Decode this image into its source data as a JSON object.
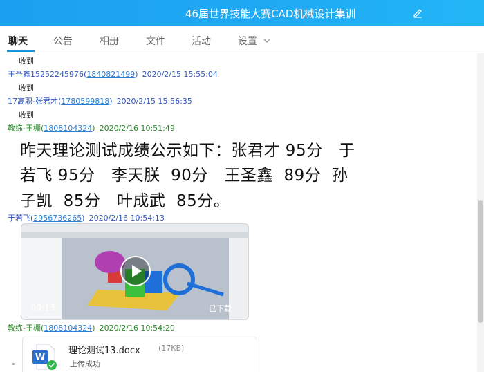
{
  "window": {
    "title": "46届世界技能大赛CAD机械设计集训"
  },
  "tabs": [
    {
      "label": "聊天",
      "active": true
    },
    {
      "label": "公告"
    },
    {
      "label": "相册"
    },
    {
      "label": "文件"
    },
    {
      "label": "活动"
    },
    {
      "label": "设置"
    }
  ],
  "messages": {
    "m1": {
      "text": "收到"
    },
    "m2": {
      "name": "王圣鑫15252245976",
      "qq": "1840821499",
      "time": "2020/2/15 15:55:04",
      "text": "收到"
    },
    "m3": {
      "name": "17高职-张君才",
      "qq": "1780599818",
      "time": "2020/2/15 15:56:35",
      "text": "收到"
    },
    "m4": {
      "name": "教练-王棚",
      "qq": "1808104324",
      "time": "2020/2/16 10:51:49",
      "text_line1": "昨天理论测试成绩公示如下：张君才 95分   于",
      "text_line2": "若飞 95分   李天朕  90分   王圣鑫  89分  孙",
      "text_line3": "子凯  85分   叶成武  85分。"
    },
    "m5": {
      "name": "于若飞",
      "qq": "2956736265",
      "time": "2020/2/16 10:54:13",
      "video_duration": "00:13",
      "video_status": "已下载"
    },
    "m6": {
      "name": "教练-王棚",
      "qq": "1808104324",
      "time": "2020/2/16 10:54:20",
      "file_name": "理论测试13.docx",
      "file_size": "(17KB)",
      "file_status": "上传成功"
    }
  },
  "colors": {
    "accent": "#1a9ff0",
    "link": "#2f7fd6",
    "sender_blue": "#2f55c0",
    "sender_green": "#2a8a2a"
  },
  "icons": {
    "title_edit": "edit-icon",
    "settings_dropdown": "chevron-down-icon",
    "file_type": "word-doc-icon",
    "upload_ok": "check-circle-icon",
    "video_play": "play-icon"
  }
}
